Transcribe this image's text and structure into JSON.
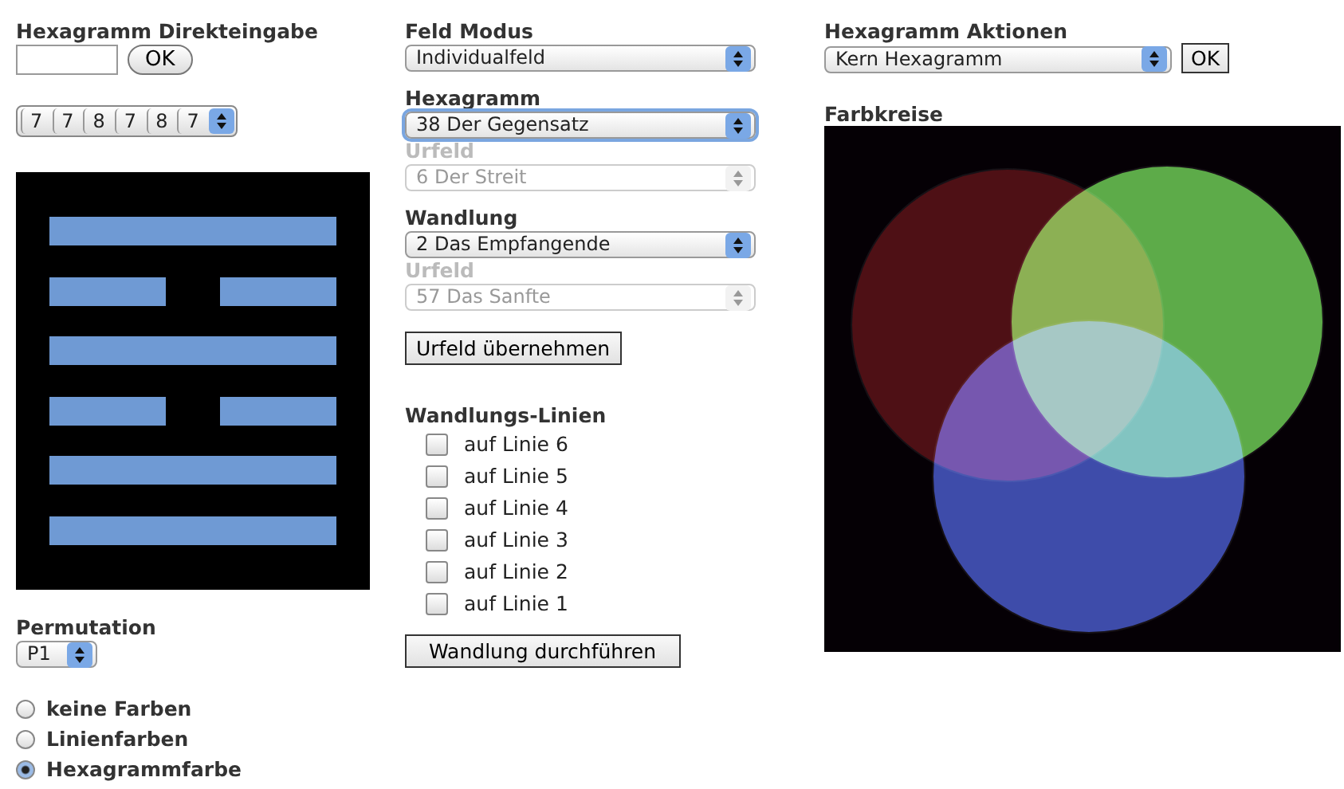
{
  "direct_input": {
    "label": "Hexagramm Direkteingabe",
    "button": "OK"
  },
  "line_values": [
    "7",
    "7",
    "8",
    "7",
    "8",
    "7"
  ],
  "hexagram_lines": [
    {
      "kind": "solid"
    },
    {
      "kind": "broken"
    },
    {
      "kind": "solid"
    },
    {
      "kind": "broken"
    },
    {
      "kind": "solid"
    },
    {
      "kind": "solid"
    }
  ],
  "permutation": {
    "label": "Permutation",
    "value": "P1"
  },
  "color_modes": [
    {
      "label": "keine Farben",
      "selected": false
    },
    {
      "label": "Linienfarben",
      "selected": false
    },
    {
      "label": "Hexagrammfarbe",
      "selected": true
    }
  ],
  "field_mode": {
    "label": "Feld Modus",
    "value": "Individualfeld",
    "focused": false
  },
  "hexagram": {
    "label": "Hexagramm",
    "value": "38 Der Gegensatz",
    "focused": true,
    "origin": {
      "label": "Urfeld",
      "value": "6 Der Streit",
      "disabled": true
    }
  },
  "transformation": {
    "label": "Wandlung",
    "value": "2 Das Empfangende",
    "focused": false,
    "origin": {
      "label": "Urfeld",
      "value": "57 Das Sanfte",
      "disabled": true
    }
  },
  "adopt_button": "Urfeld übernehmen",
  "transformation_lines": {
    "label": "Wandlungs-Linien",
    "items": [
      {
        "label": "auf Linie 6",
        "checked": false
      },
      {
        "label": "auf Linie 5",
        "checked": false
      },
      {
        "label": "auf Linie 4",
        "checked": false
      },
      {
        "label": "auf Linie 3",
        "checked": false
      },
      {
        "label": "auf Linie 2",
        "checked": false
      },
      {
        "label": "auf Linie 1",
        "checked": false
      }
    ]
  },
  "execute_button": "Wandlung durchführen",
  "actions": {
    "label": "Hexagramm Aktionen",
    "value": "Kern Hexagramm",
    "button": "OK"
  },
  "color_circles": {
    "label": "Farbkreise",
    "circles": [
      {
        "color": "#4a1010"
      },
      {
        "color": "#5aab45"
      },
      {
        "color": "#3a4ca8"
      }
    ]
  }
}
